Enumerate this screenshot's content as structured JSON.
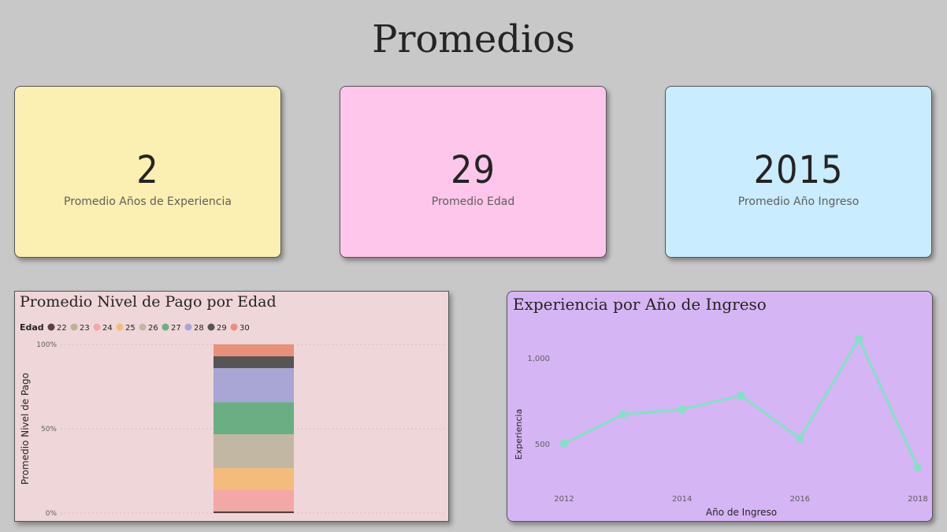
{
  "title": "Promedios",
  "kpis": [
    {
      "value": "2",
      "label": "Promedio Años de Experiencia",
      "color": "#fbefb1"
    },
    {
      "value": "29",
      "label": "Promedio Edad",
      "color": "#fdc6ea"
    },
    {
      "value": "2015",
      "label": "Promedio Año Ingreso",
      "color": "#c9ecfe"
    }
  ],
  "chart_data": [
    {
      "type": "bar",
      "title": "Promedio Nivel de Pago por Edad",
      "legend_title": "Edad",
      "legend_placement": "top-left",
      "ylabel": "Promedio Nivel de Pago",
      "yticks": [
        "100%",
        "50%",
        "0%"
      ],
      "stacked": "100%",
      "series": [
        {
          "name": "22",
          "value": 1,
          "color": "#5b3e3e"
        },
        {
          "name": "23",
          "value": 0.5,
          "color": "#bdb28f"
        },
        {
          "name": "24",
          "value": 12,
          "color": "#f4a7a7"
        },
        {
          "name": "25",
          "value": 13,
          "color": "#f4bc7c"
        },
        {
          "name": "26",
          "value": 20,
          "color": "#c2b7a3"
        },
        {
          "name": "27",
          "value": 19,
          "color": "#6cae84"
        },
        {
          "name": "28",
          "value": 20,
          "color": "#a9a6d5"
        },
        {
          "name": "29",
          "value": 7,
          "color": "#555555"
        },
        {
          "name": "30",
          "value": 7,
          "color": "#e8907a"
        }
      ],
      "background": "#efd6d8"
    },
    {
      "type": "line",
      "title": "Experiencia por Año de Ingreso",
      "xlabel": "Año de Ingreso",
      "ylabel": "Experiencia",
      "x": [
        2012,
        2013,
        2014,
        2015,
        2016,
        2017,
        2018
      ],
      "y": [
        500,
        670,
        700,
        780,
        530,
        1110,
        360
      ],
      "xticks": [
        "2012",
        "2014",
        "2016",
        "2018"
      ],
      "yticks": [
        {
          "value": 1000,
          "label": "1,000"
        },
        {
          "value": 500,
          "label": "500"
        }
      ],
      "ylim": [
        210,
        1220
      ],
      "line_color": "#7fe3c3",
      "background": "#d5b5f3"
    }
  ]
}
